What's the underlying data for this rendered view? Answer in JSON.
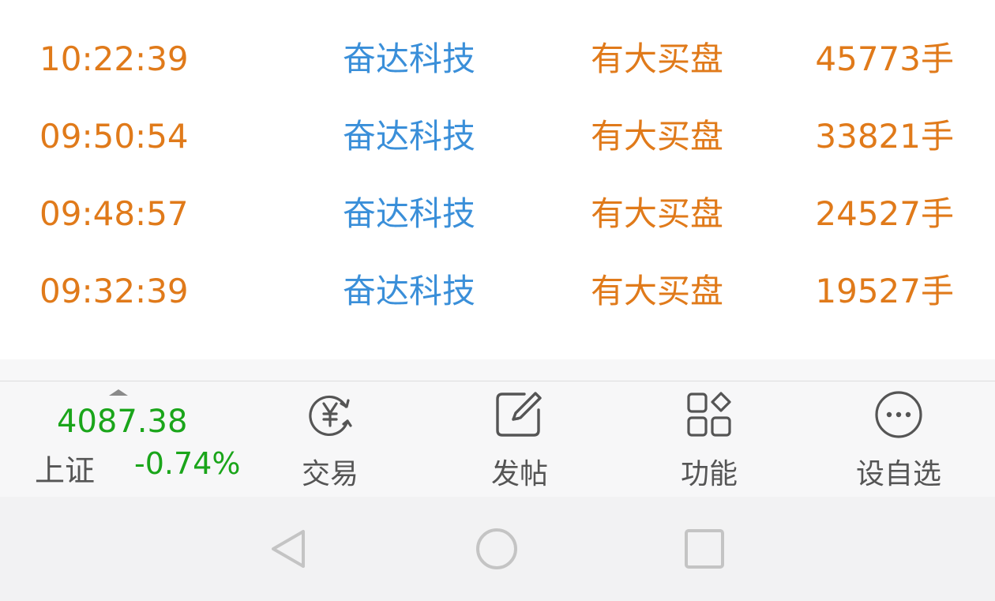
{
  "trades": [
    {
      "time": "10:22:39",
      "name": "奋达科技",
      "type": "有大买盘",
      "volume": "45773手"
    },
    {
      "time": "09:50:54",
      "name": "奋达科技",
      "type": "有大买盘",
      "volume": "33821手"
    },
    {
      "time": "09:48:57",
      "name": "奋达科技",
      "type": "有大买盘",
      "volume": "24527手"
    },
    {
      "time": "09:32:39",
      "name": "奋达科技",
      "type": "有大买盘",
      "volume": "19527手"
    }
  ],
  "index": {
    "value": "4087.38",
    "name": "上证",
    "change": "-0.74%"
  },
  "toolbar": {
    "trade_label": "交易",
    "post_label": "发帖",
    "function_label": "功能",
    "watch_label": "设自选"
  },
  "colors": {
    "time": "#e07a1a",
    "stock_name": "#3a8fd9",
    "index_down": "#1aa51a"
  },
  "icons": {
    "trade": "yen-exchange-icon",
    "post": "edit-icon",
    "function": "apps-grid-icon",
    "watch": "more-circle-icon",
    "nav_back": "back-triangle-icon",
    "nav_home": "home-circle-icon",
    "nav_recent": "recent-square-icon"
  }
}
